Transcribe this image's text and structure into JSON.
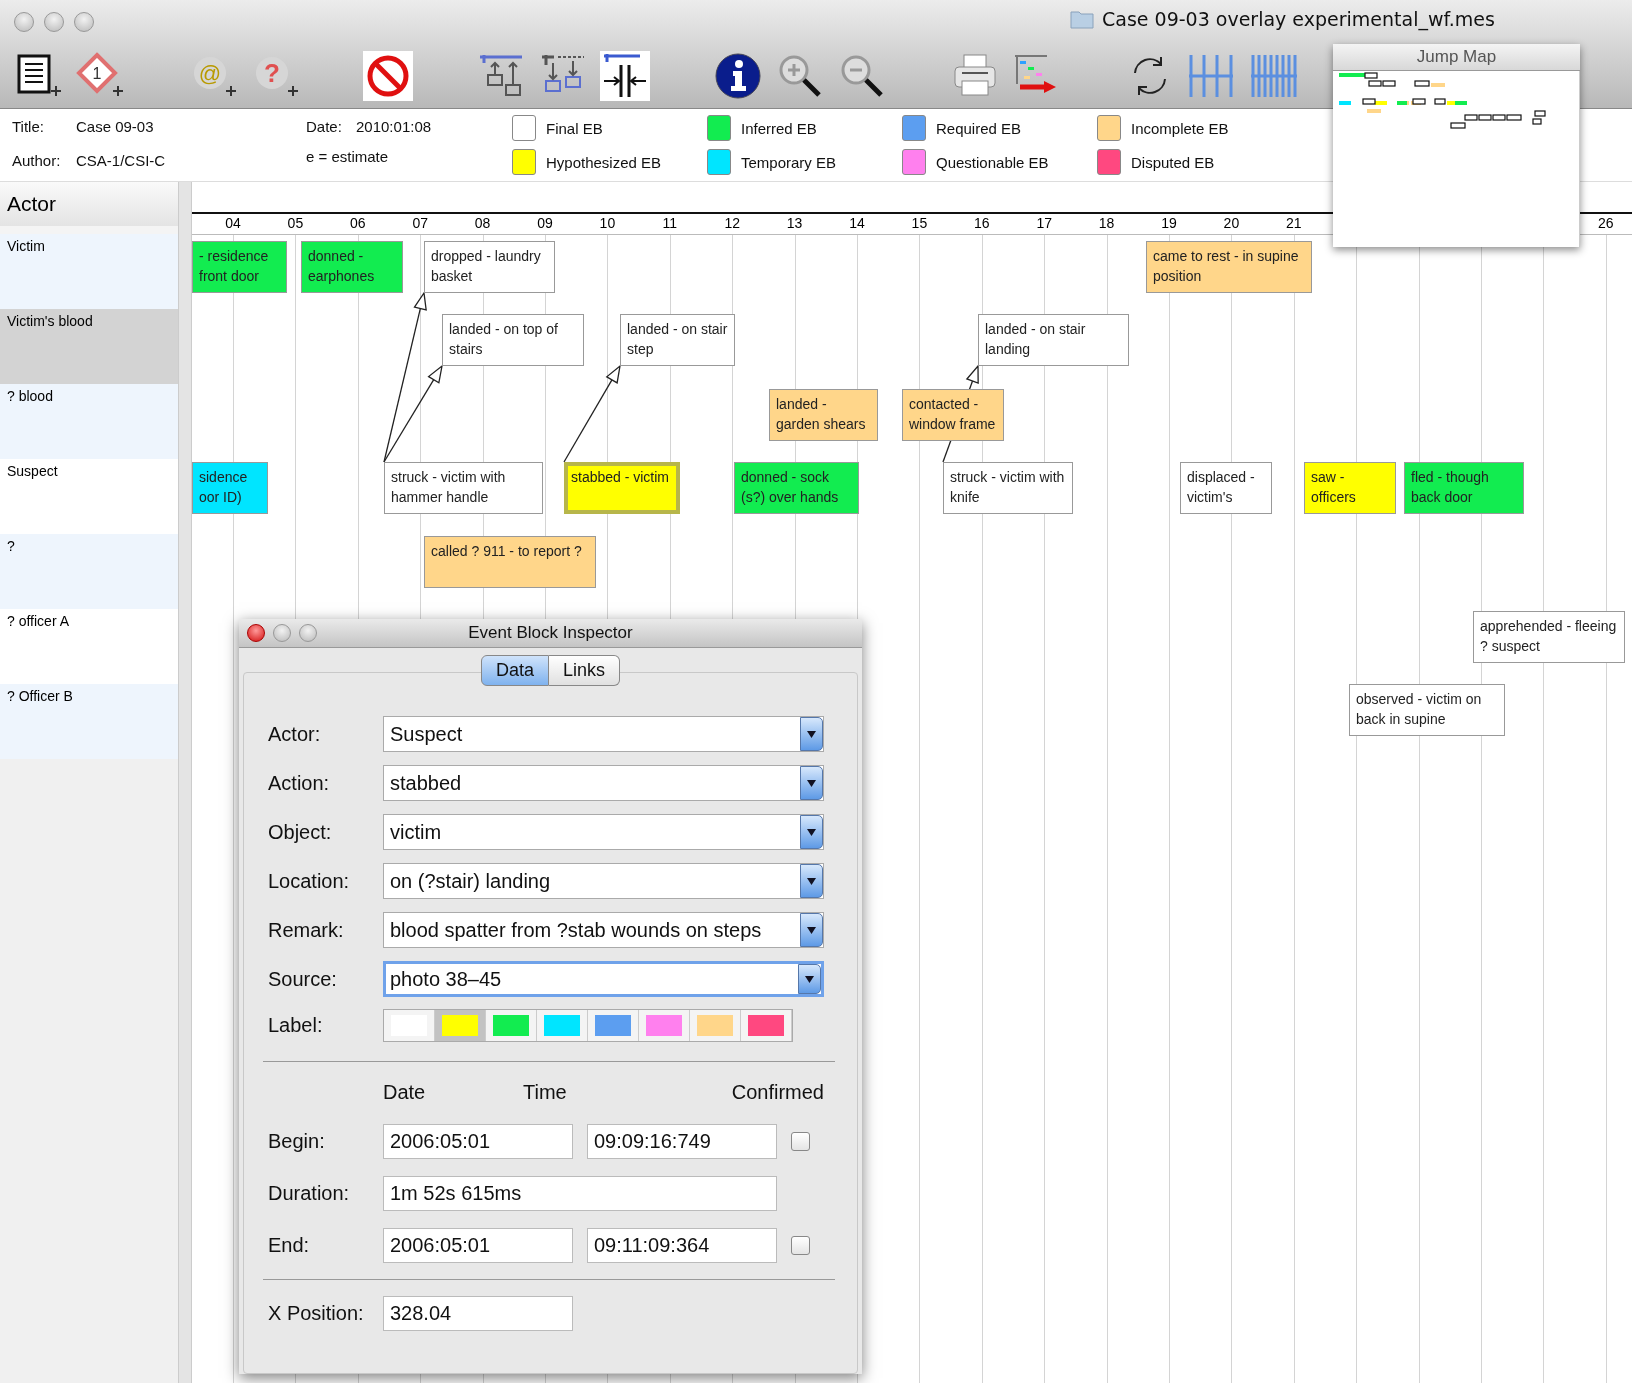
{
  "window": {
    "title": "Case 09-03 overlay experimental_wf.mes"
  },
  "toolbar": [
    {
      "kind": "document-add"
    },
    {
      "kind": "event-add",
      "glyph": "1"
    },
    {
      "kind": "email-add",
      "glyph": "@"
    },
    {
      "kind": "question-add",
      "glyph": "?"
    },
    {
      "kind": "prohibit"
    },
    {
      "kind": "align-up"
    },
    {
      "kind": "align-down"
    },
    {
      "kind": "compress"
    },
    {
      "kind": "info"
    },
    {
      "kind": "zoom-in"
    },
    {
      "kind": "zoom-out"
    },
    {
      "kind": "print"
    },
    {
      "kind": "export"
    },
    {
      "kind": "refresh"
    },
    {
      "kind": "grid-wide"
    },
    {
      "kind": "grid-narrow"
    }
  ],
  "case_info": {
    "title_label": "Title:",
    "title": "Case 09-03",
    "author_label": "Author:",
    "author": "CSA-1/CSI-C",
    "date_label": "Date:",
    "date": "2010:01:08",
    "note": "e = estimate"
  },
  "legend": [
    {
      "label": "Final EB",
      "color": "#ffffff"
    },
    {
      "label": "Inferred EB",
      "color": "#12ec50"
    },
    {
      "label": "Required EB",
      "color": "#5c9ef0"
    },
    {
      "label": "Incomplete EB",
      "color": "#ffd68a"
    },
    {
      "label": "Hypothesized EB",
      "color": "#ffff00"
    },
    {
      "label": "Temporary EB",
      "color": "#00e5ff"
    },
    {
      "label": "Questionable EB",
      "color": "#ff80ee"
    },
    {
      "label": "Disputed EB",
      "color": "#ff4880"
    }
  ],
  "jump_map": {
    "title": "Jump Map"
  },
  "actors": {
    "heading": "Actor",
    "rows": [
      {
        "name": "Victim",
        "selected": false
      },
      {
        "name": "Victim's blood",
        "selected": true
      },
      {
        "name": "? blood",
        "selected": false
      },
      {
        "name": "Suspect",
        "selected": false
      },
      {
        "name": "?",
        "selected": false
      },
      {
        "name": "? officer A",
        "selected": false
      },
      {
        "name": "? Officer B",
        "selected": false
      }
    ]
  },
  "timeline": {
    "ticks": [
      "04",
      "05",
      "06",
      "07",
      "08",
      "09",
      "10",
      "11",
      "12",
      "13",
      "14",
      "15",
      "16",
      "17",
      "18",
      "19",
      "20",
      "21",
      "26"
    ],
    "events": [
      {
        "text": "- residence front door",
        "color": "#12ec50",
        "selected": false
      },
      {
        "text": "donned - earphones",
        "color": "#12ec50",
        "selected": false
      },
      {
        "text": "dropped - laundry basket",
        "color": "#ffffff",
        "selected": false
      },
      {
        "text": "came to rest - in supine position",
        "color": "#ffd68a",
        "selected": false
      },
      {
        "text": "landed - on top of stairs",
        "color": "#ffffff",
        "selected": false
      },
      {
        "text": "landed - on stair step",
        "color": "#ffffff",
        "selected": false
      },
      {
        "text": "landed - on stair landing",
        "color": "#ffffff",
        "selected": false
      },
      {
        "text": "landed - garden shears",
        "color": "#ffd68a",
        "selected": false
      },
      {
        "text": "contacted - window frame",
        "color": "#ffd68a",
        "selected": false
      },
      {
        "text": "sidence oor ID)",
        "color": "#00e5ff",
        "selected": false
      },
      {
        "text": "struck - victim with hammer handle",
        "color": "#ffffff",
        "selected": false
      },
      {
        "text": "stabbed - victim",
        "color": "#ffff00",
        "selected": true
      },
      {
        "text": "donned - sock (s?) over hands",
        "color": "#12ec50",
        "selected": false
      },
      {
        "text": "struck - victim with knife",
        "color": "#ffffff",
        "selected": false
      },
      {
        "text": "displaced - victim's",
        "color": "#ffffff",
        "selected": false
      },
      {
        "text": "saw - officers",
        "color": "#ffff00",
        "selected": false
      },
      {
        "text": "fled - though back door",
        "color": "#12ec50",
        "selected": false
      },
      {
        "text": "called ? 911 - to report ?",
        "color": "#ffd68a",
        "selected": false
      },
      {
        "text": "apprehended - fleeing ? suspect",
        "color": "#ffffff",
        "selected": false
      },
      {
        "text": "observed - victim on back in supine",
        "color": "#ffffff",
        "selected": false
      }
    ]
  },
  "inspector": {
    "title": "Event Block Inspector",
    "tabs": [
      {
        "label": "Data",
        "selected": true
      },
      {
        "label": "Links",
        "selected": false
      }
    ],
    "fields": [
      {
        "label": "Actor:",
        "value": "Suspect",
        "focused": false
      },
      {
        "label": "Action:",
        "value": "stabbed",
        "focused": false
      },
      {
        "label": "Object:",
        "value": "victim",
        "focused": false
      },
      {
        "label": "Location:",
        "value": "on (?stair) landing",
        "focused": false
      },
      {
        "label": "Remark:",
        "value": "blood spatter from ?stab wounds on steps",
        "focused": false
      },
      {
        "label": "Source:",
        "value": "photo 38–45",
        "focused": true
      }
    ],
    "label_row": {
      "label": "Label:",
      "swatches": [
        {
          "color": "#ffffff",
          "selected": false
        },
        {
          "color": "#ffff00",
          "selected": true
        },
        {
          "color": "#12ec50",
          "selected": false
        },
        {
          "color": "#00e5ff",
          "selected": false
        },
        {
          "color": "#5c9ef0",
          "selected": false
        },
        {
          "color": "#ff80ee",
          "selected": false
        },
        {
          "color": "#ffd68a",
          "selected": false
        },
        {
          "color": "#ff4880",
          "selected": false
        }
      ]
    },
    "columns": [
      "Date",
      "Time",
      "Confirmed"
    ],
    "begin": {
      "label": "Begin:",
      "date": "2006:05:01",
      "time": "09:09:16:749",
      "confirmed": false
    },
    "duration": {
      "label": "Duration:",
      "value": "1m 52s 615ms"
    },
    "end": {
      "label": "End:",
      "date": "2006:05:01",
      "time": "09:11:09:364",
      "confirmed": false
    },
    "x_position": {
      "label": "X Position:",
      "value": "328.04"
    }
  }
}
